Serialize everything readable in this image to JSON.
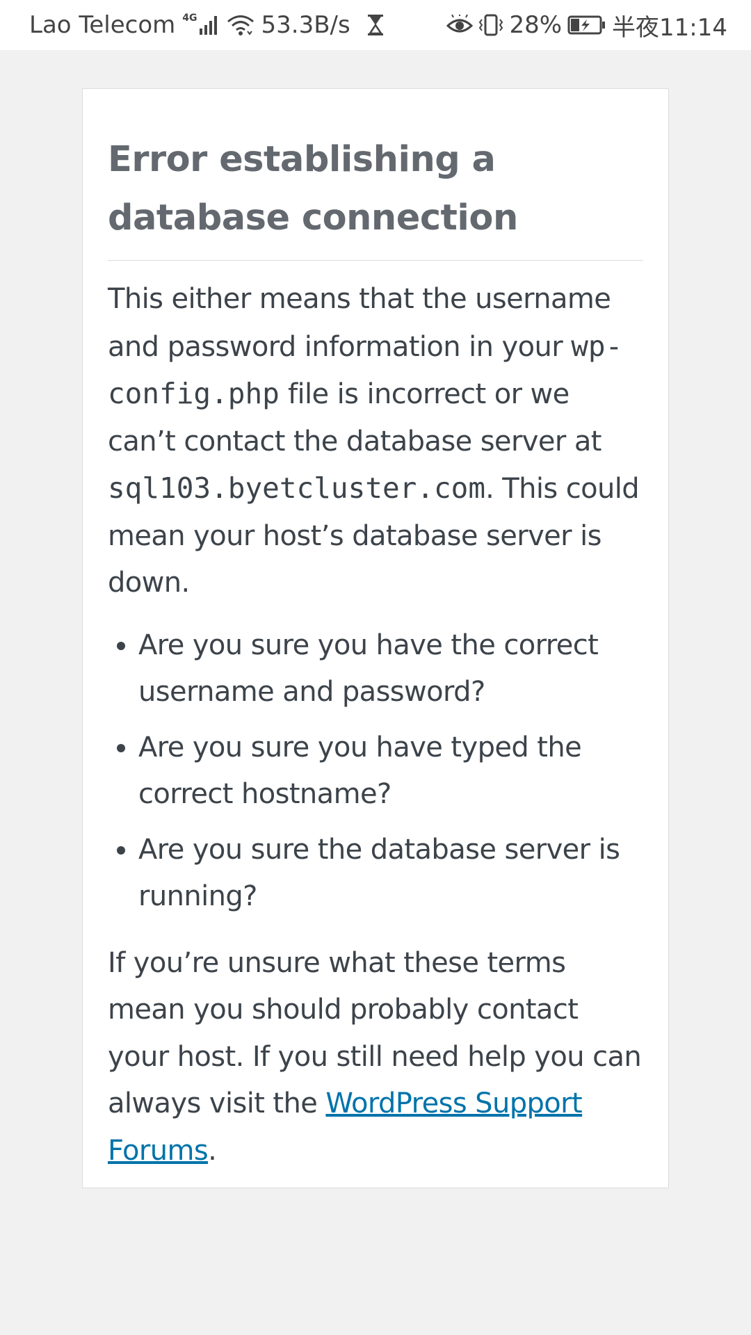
{
  "status_bar": {
    "carrier": "Lao Telecom",
    "network_type": "4G",
    "signal_icon": "signal-bars-icon",
    "wifi_icon": "wifi-icon",
    "speed": "53.3B/s",
    "hourglass_icon": "hourglass-icon",
    "eye_icon": "eye-comfort-icon",
    "vibrate_icon": "vibrate-icon",
    "battery_percent": "28%",
    "battery_icon": "battery-charging-icon",
    "time": "半夜11:14"
  },
  "error": {
    "title": "Error establishing a database connection",
    "intro_part1": "This either means that the username and password information in your ",
    "config_file": "wp-config.php",
    "intro_part2": " file is incorrect or we can’t contact the database server at ",
    "db_host": "sql103.byetcluster.com",
    "intro_part3": ". This could mean your host’s database server is down.",
    "bullets": [
      "Are you sure you have the correct username and password?",
      "Are you sure you have typed the correct hostname?",
      "Are you sure the database server is running?"
    ],
    "footer_part1": "If you’re unsure what these terms mean you should probably contact your host. If you still need help you can always visit the ",
    "link_text": "WordPress Support Forums",
    "footer_part2": "."
  },
  "colors": {
    "page_background": "#f1f1f1",
    "card_background": "#ffffff",
    "title_color": "#646970",
    "text_color": "#3c434a",
    "link_color": "#0073aa"
  }
}
